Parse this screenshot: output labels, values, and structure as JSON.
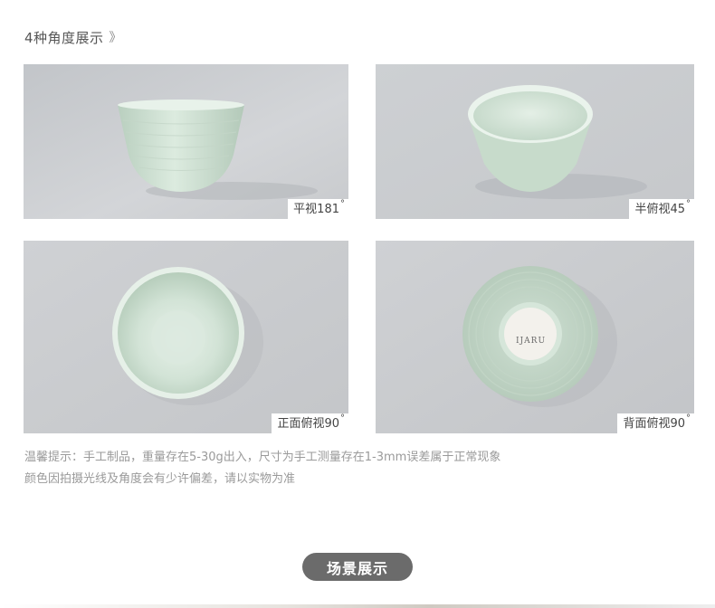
{
  "section": {
    "title": "4种角度展示",
    "chevron": "》"
  },
  "photos": [
    {
      "label": "平视181",
      "degree": "°"
    },
    {
      "label": "半俯视45",
      "degree": "°"
    },
    {
      "label": "正面俯视90",
      "degree": "°"
    },
    {
      "label": "背面俯视90",
      "degree": "°"
    }
  ],
  "bowl_stamp": "IJARU",
  "notes": {
    "line1": "温馨提示：手工制品，重量存在5-30g出入，尺寸为手工测量存在1-3mm误差属于正常现象",
    "line2": "颜色因拍摄光线及角度会有少许偏差，请以实物为准"
  },
  "scene_button": "场景展示",
  "colors": {
    "backdrop": "#c9ccd0",
    "celadon": "#cfe3d3",
    "pill": "#6b6b6b"
  }
}
